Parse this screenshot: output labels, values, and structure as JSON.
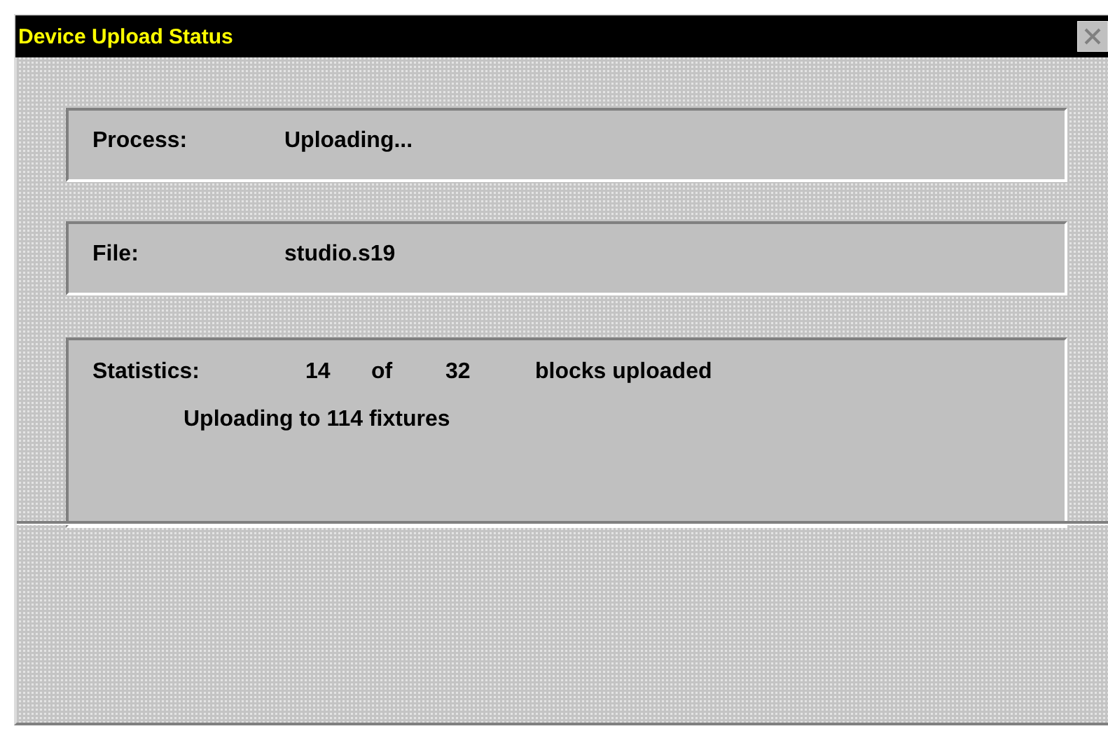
{
  "window": {
    "title": "Device Upload Status"
  },
  "panels": [
    {
      "label": "Process:",
      "value": "Uploading..."
    },
    {
      "label": "File:",
      "value": "studio.s19"
    }
  ],
  "statistics": {
    "label": "Statistics:",
    "uploaded": "14",
    "of": "of",
    "total": "32",
    "unit": "blocks uploaded",
    "detail": "Uploading to 114 fixtures"
  }
}
